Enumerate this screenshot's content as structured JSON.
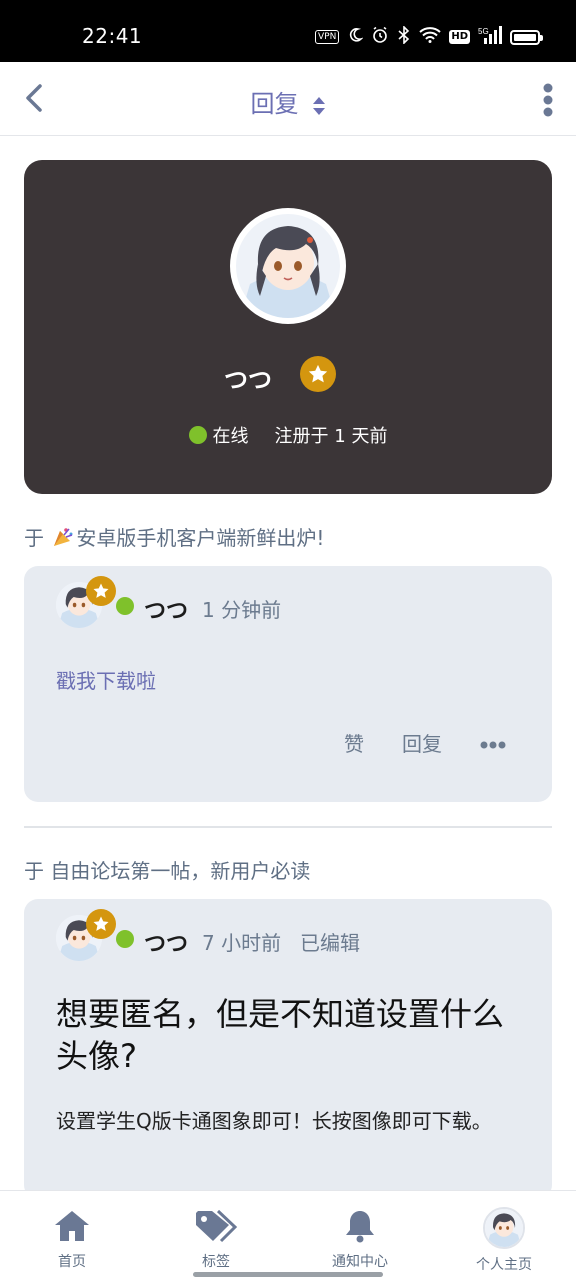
{
  "status_bar": {
    "time": "22:41",
    "vpn": "VPN",
    "hd": "HD",
    "network": "5G"
  },
  "header": {
    "title": "回复",
    "back_icon": "chevron-left-icon",
    "sort_icon": "sort-icon",
    "more_icon": "more-vertical-icon"
  },
  "profile": {
    "name": "つつ",
    "status": "在线",
    "registered": "注册于 1 天前"
  },
  "posts": [
    {
      "context_prefix": "于",
      "context_title": "安卓版手机客户端新鲜出炉!",
      "author": "つつ",
      "time": "1 分钟前",
      "edited": "",
      "content": "戳我下载啦",
      "actions": {
        "like": "赞",
        "reply": "回复"
      }
    },
    {
      "context_prefix": "于",
      "context_title": "自由论坛第一帖，新用户必读",
      "author": "つつ",
      "time": "7 小时前",
      "edited": "已编辑",
      "title": "想要匿名，但是不知道设置什么头像?",
      "body": "设置学生Q版卡通图象即可！长按图像即可下载。"
    }
  ],
  "bottom_nav": [
    {
      "label": "首页",
      "icon": "home-icon"
    },
    {
      "label": "标签",
      "icon": "tag-icon"
    },
    {
      "label": "通知中心",
      "icon": "bell-icon"
    },
    {
      "label": "个人主页",
      "icon": "avatar"
    }
  ],
  "colors": {
    "accent": "#6b6fb3",
    "card_dark": "#3b3537",
    "badge": "#d4960f",
    "online": "#7fc12b",
    "post_bg": "#e7ebf1"
  }
}
